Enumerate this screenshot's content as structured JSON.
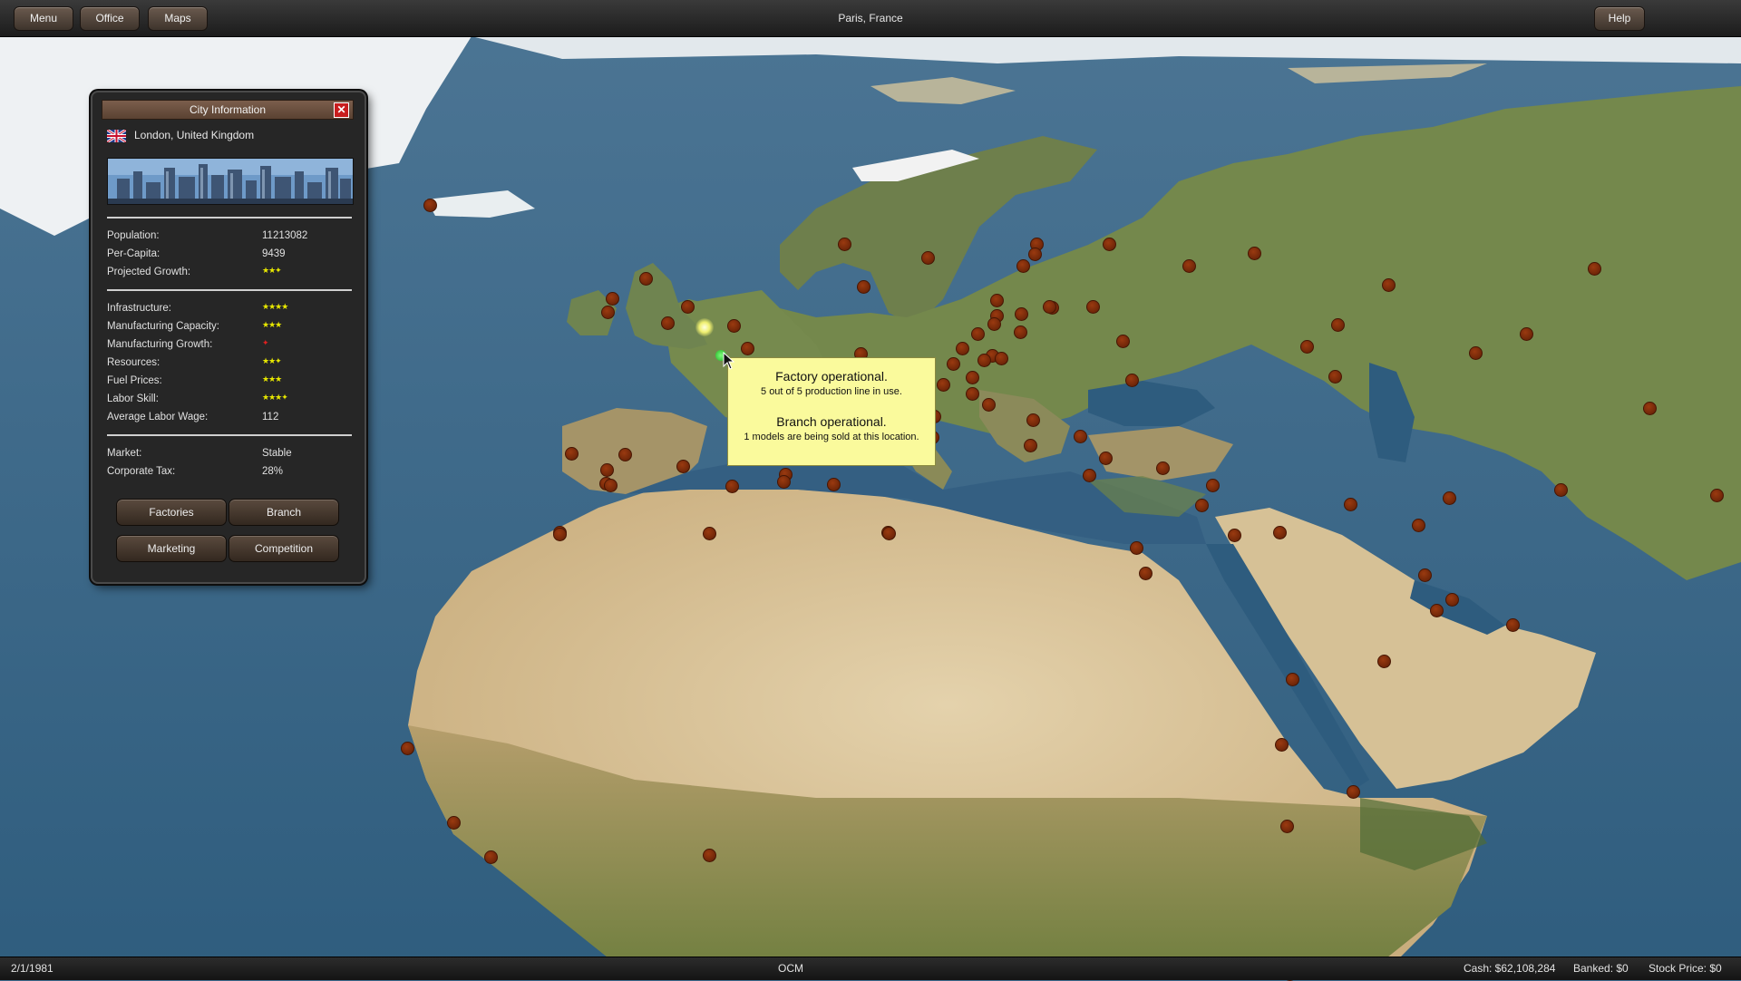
{
  "topbar": {
    "menu_label": "Menu",
    "office_label": "Office",
    "maps_label": "Maps",
    "location": "Paris,  France",
    "help_label": "Help"
  },
  "city_panel": {
    "title": "City Information",
    "city": "London,  United Kingdom",
    "flag_icon": "uk-flag-icon",
    "stats": [
      {
        "label": "Population:",
        "value": "11213082"
      },
      {
        "label": "Per-Capita:",
        "value": "9439"
      },
      {
        "label": "Projected Growth:",
        "stars": 2.5
      }
    ],
    "ratings": [
      {
        "label": "Infrastructure:",
        "stars": 4
      },
      {
        "label": "Manufacturing Capacity:",
        "stars": 3
      },
      {
        "label": "Manufacturing Growth:",
        "stars": 0.5,
        "color": "#e02020"
      },
      {
        "label": "Resources:",
        "stars": 2.5
      },
      {
        "label": "Fuel Prices:",
        "stars": 3
      },
      {
        "label": "Labor Skill:",
        "stars": 3.5
      },
      {
        "label": "Average Labor Wage:",
        "value": "112"
      }
    ],
    "market": [
      {
        "label": "Market:",
        "value": "Stable"
      },
      {
        "label": "Corporate Tax:",
        "value": "28%"
      }
    ],
    "buttons": {
      "factories": "Factories",
      "branch": "Branch",
      "marketing": "Marketing",
      "competition": "Competition"
    }
  },
  "tooltip": {
    "factory_title": "Factory operational.",
    "factory_detail": "5 out of 5 production line in use.",
    "branch_title": "Branch operational.",
    "branch_detail": "1 models are being sold at this location."
  },
  "bottombar": {
    "date": "2/1/1981",
    "company": "OCM",
    "cash": "Cash:  $62,108,284",
    "banked": "Banked:  $0",
    "stock_price": "Stock Price:  $0"
  },
  "colors": {
    "city_marker": "#7a2a0a",
    "highlight": "#f0f070",
    "tooltip_bg": "#fafa9c",
    "star": "#e8e800"
  }
}
